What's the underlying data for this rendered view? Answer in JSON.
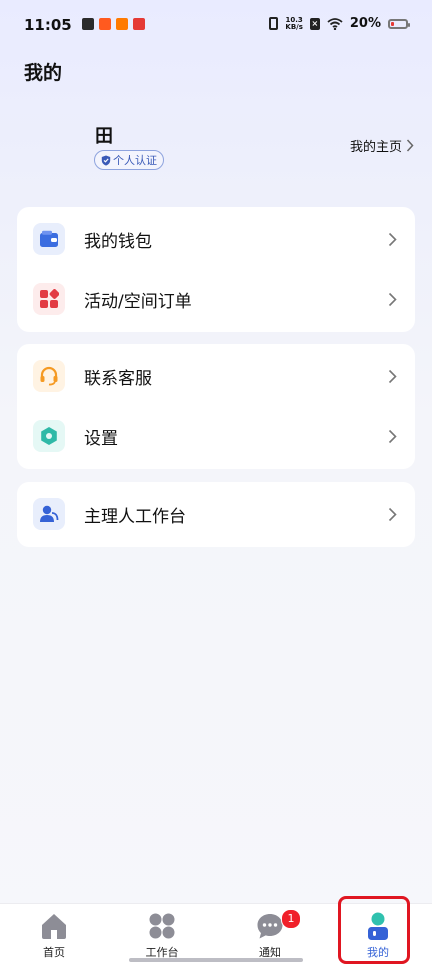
{
  "status_bar": {
    "time": "11:05",
    "net_speed_value": "10.3",
    "net_speed_unit": "KB/s",
    "sim_status": "×",
    "battery_percent_text": "20%",
    "battery_level": 0.2,
    "app_icon_colors": [
      "#2b2b2b",
      "#ff5a1f",
      "#ff7a00",
      "#e53935"
    ],
    "battery_color": "#e53935"
  },
  "page": {
    "title": "我的"
  },
  "profile": {
    "name": "田",
    "verification_badge": "个人认证",
    "home_link": "我的主页"
  },
  "menu_groups": [
    {
      "items": [
        {
          "label": "我的钱包",
          "icon": "wallet-icon",
          "color": "#3b6de0",
          "bg": "#e8eefc"
        },
        {
          "label": "活动/空间订单",
          "icon": "apps-icon",
          "color": "#e23b44",
          "bg": "#fdecec"
        }
      ]
    },
    {
      "items": [
        {
          "label": "联系客服",
          "icon": "headset-icon",
          "color": "#f59a23",
          "bg": "#fff3e3"
        },
        {
          "label": "设置",
          "icon": "gear-icon",
          "color": "#2fb9a7",
          "bg": "#e5f8f5"
        }
      ]
    },
    {
      "items": [
        {
          "label": "主理人工作台",
          "icon": "user-badge-icon",
          "color": "#3562d6",
          "bg": "#e8eefc"
        }
      ]
    }
  ],
  "tab_bar": {
    "tabs": [
      {
        "label": "首页",
        "icon": "home-icon"
      },
      {
        "label": "工作台",
        "icon": "grid-icon"
      },
      {
        "label": "通知",
        "icon": "chat-icon",
        "badge": "1"
      },
      {
        "label": "我的",
        "icon": "person-icon",
        "active": true
      }
    ],
    "active_color": "#3562d6",
    "highlight_color": "#e01621"
  }
}
